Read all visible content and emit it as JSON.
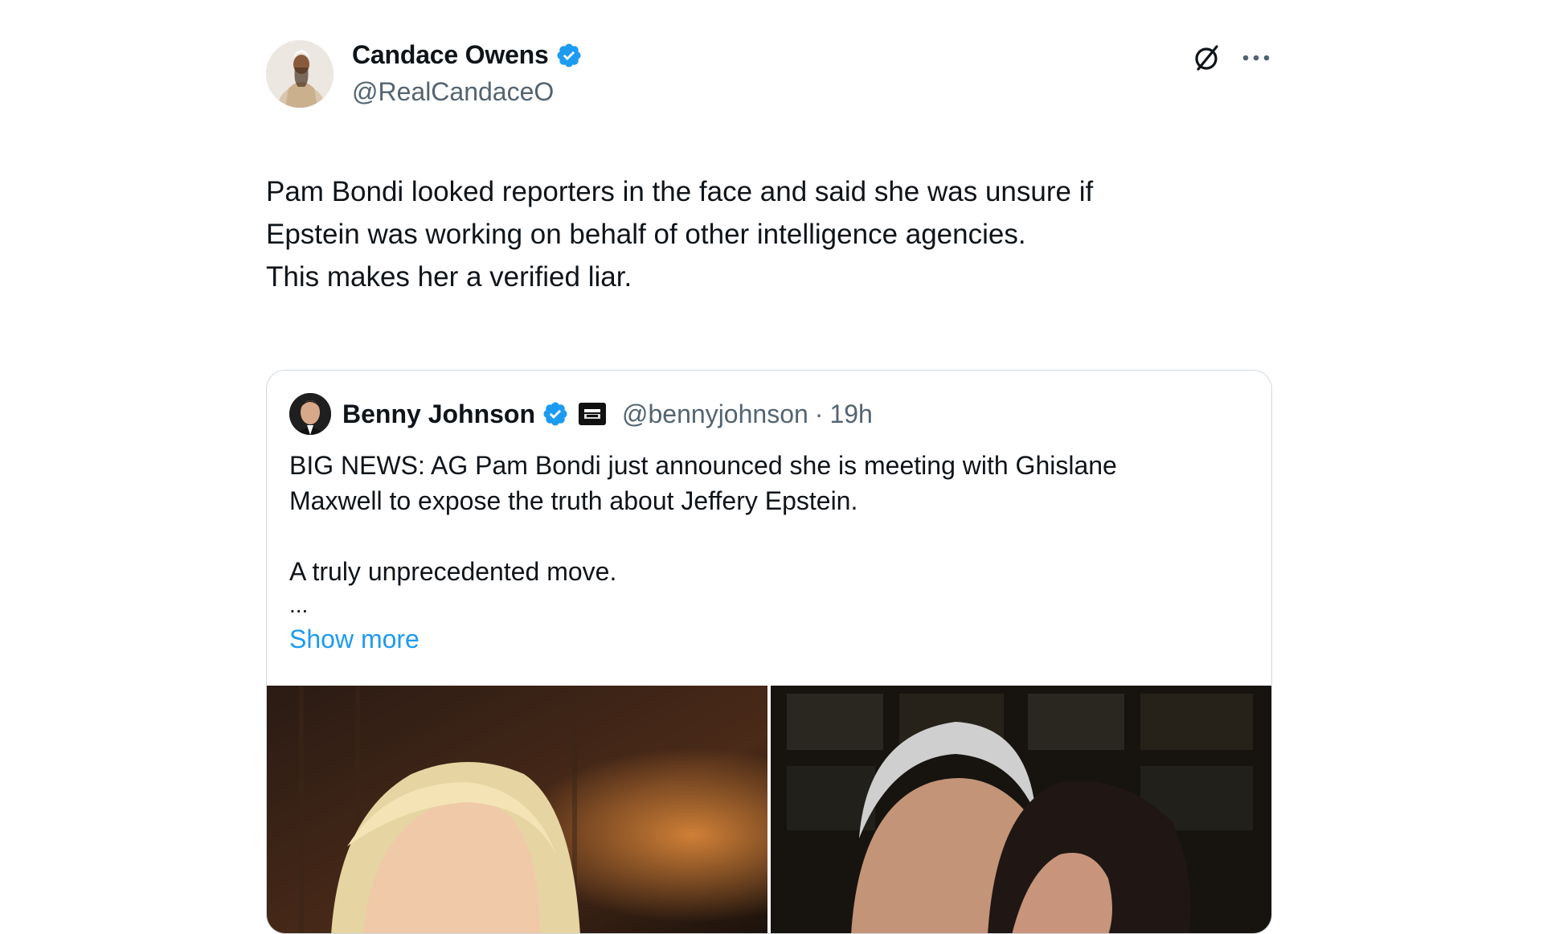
{
  "author": {
    "display_name": "Candace Owens",
    "handle": "@RealCandaceO",
    "verified_color": "#1d9bf0"
  },
  "icons": {
    "grok": "grok-icon",
    "more": "more-icon",
    "verified": "verified-badge-icon",
    "affiliation": "affiliation-badge-icon"
  },
  "tweet": {
    "lines": [
      "Pam Bondi looked reporters in the face and said she was unsure if",
      "Epstein was working on behalf of other intelligence agencies.",
      "This makes her a verified liar."
    ]
  },
  "quote": {
    "display_name": "Benny Johnson",
    "handle": "@bennyjohnson",
    "separator": "·",
    "time": "19h",
    "body_lines": [
      "BIG NEWS: AG Pam Bondi just announced she is meeting with Ghislane",
      "Maxwell to expose the truth about Jeffery Epstein."
    ],
    "body_line_2": "A truly unprecedented move.",
    "ellipsis": "...",
    "show_more": "Show more",
    "media": [
      {
        "alt_icon": "photo-woman-blonde"
      },
      {
        "alt_icon": "photo-man-and-woman"
      }
    ]
  },
  "colors": {
    "text": "#0f1419",
    "secondary": "#536471",
    "link": "#1d9bf0",
    "border": "#cfd9de"
  }
}
